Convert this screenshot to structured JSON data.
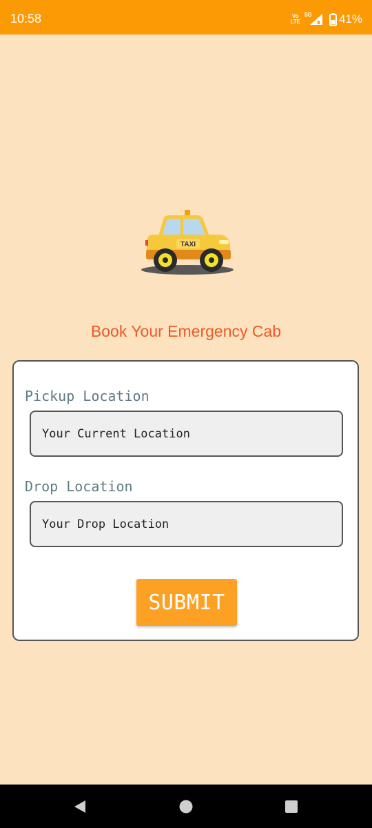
{
  "status_bar": {
    "time": "10:58",
    "volte_top": "Vo",
    "volte_bottom": "LTE",
    "network": "5G",
    "battery": "41%"
  },
  "hero": {
    "image_icon": "taxi-car-illustration",
    "taxi_sign": "TAXI"
  },
  "title": "Book Your Emergency Cab",
  "form": {
    "pickup_label": "Pickup Location",
    "pickup_placeholder": "Your Current Location",
    "drop_label": "Drop Location",
    "drop_placeholder": "Your Drop Location",
    "submit_label": "SUBMIT"
  },
  "nav_bar": {
    "back_icon": "back-triangle-icon",
    "home_icon": "home-circle-icon",
    "recents_icon": "recents-square-icon"
  },
  "colors": {
    "status_bar": "#fb9a05",
    "background": "#fde2c0",
    "title": "#ec5a27",
    "label": "#5d7c86",
    "submit": "#fda125"
  }
}
